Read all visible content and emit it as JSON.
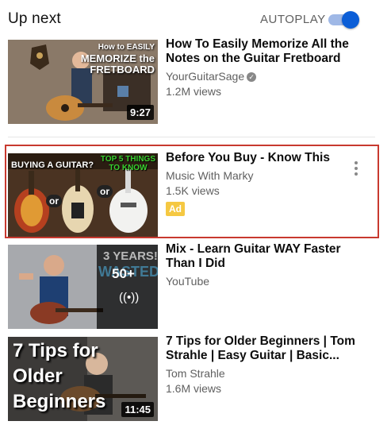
{
  "header": {
    "title": "Up next",
    "autoplay_label": "AUTOPLAY",
    "autoplay_on": true
  },
  "videos": [
    {
      "title": "How To Easily Memorize All the Notes on the Guitar Fretboard",
      "channel": "YourGuitarSage",
      "verified": true,
      "views": "1.2M views",
      "duration": "9:27",
      "thumb_text": [
        "How to EASILY",
        "MEMORIZE the",
        "FRETBOARD"
      ]
    },
    {
      "title": "Before You Buy - Know This",
      "channel": "Music With Marky",
      "views": "1.5K views",
      "badge": "Ad",
      "highlighted": true,
      "thumb_text": [
        "BUYING A GUITAR?",
        "TOP 5 THINGS",
        "TO KNOW",
        "or",
        "or"
      ]
    },
    {
      "title": "Mix - Learn Guitar WAY Faster Than I Did",
      "channel": "YouTube",
      "mix_count": "50+",
      "thumb_text": [
        "3 YEARS!",
        "WASTED"
      ]
    },
    {
      "title": "7 Tips for Older Beginners | Tom Strahle | Easy Guitar | Basic...",
      "channel": "Tom Strahle",
      "views": "1.6M views",
      "duration": "11:45",
      "thumb_text": [
        "7 Tips for",
        "Older",
        "Beginners"
      ]
    }
  ],
  "colors": {
    "toggle_knob": "#0b5ed7",
    "toggle_track": "#9fb8e6",
    "ad_badge": "#f5c842",
    "highlight_border": "#c8392f"
  }
}
